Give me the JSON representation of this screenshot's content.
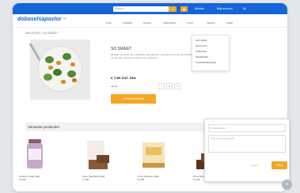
{
  "header": {
    "search_placeholder": "Zoeken",
    "search_icon": "search-icon",
    "cart_icon": "cart-icon",
    "links": [
      "Afhalen",
      "Mijn account",
      "NL"
    ]
  },
  "logo": {
    "text": "dobaselsapastor",
    "accent": "#1565d8"
  },
  "nav": {
    "items": [
      "LIVE",
      "KANSEN",
      "ZAKEN",
      "WELLNESS",
      "TOFU",
      "VEGAN",
      "SOEP"
    ]
  },
  "breadcrumb": "HOLASTER > SO SWEET",
  "dropdown": {
    "items": [
      "SATURNE",
      "MATCHA'S",
      "KOEKJES",
      "SNOEPJES",
      "TAARTENBAKKEN"
    ]
  },
  "product": {
    "title": "SO SWEET",
    "description": "Heerlijk, gemaakt van natuurlijke ingrediënten, overtuig je zelf van de heerlijke smaak, ideaal voor elk moment van de dag. Glutenvrij, lactosevrij, suikervrij.",
    "price": "€ 7,90 incl. btw",
    "qty_label": "aantal:",
    "qty_value": "1",
    "qty_minus": "−",
    "qty_plus": "+",
    "order_button": "WINKELWAGEN"
  },
  "related": {
    "title": "Verwante producten",
    "items": [
      {
        "name": "Syrahm Lekker 50g",
        "price": "€ 2,95"
      },
      {
        "name": "Choc Specialist 150g",
        "price": "€ 3,95"
      },
      {
        "name": "Choc Fillissies 150g",
        "price": "€ 3,95"
      },
      {
        "name": "Choc Disruptive 150g",
        "price": "€ 3,95"
      }
    ]
  },
  "chat": {
    "email_placeholder": "Email address",
    "message_placeholder": "How can we help you?",
    "cancel_label": "Cancel",
    "send_label": "Send"
  },
  "close_icon": "close-icon",
  "colors": {
    "primary": "#1565d8",
    "accent": "#f5a623"
  }
}
